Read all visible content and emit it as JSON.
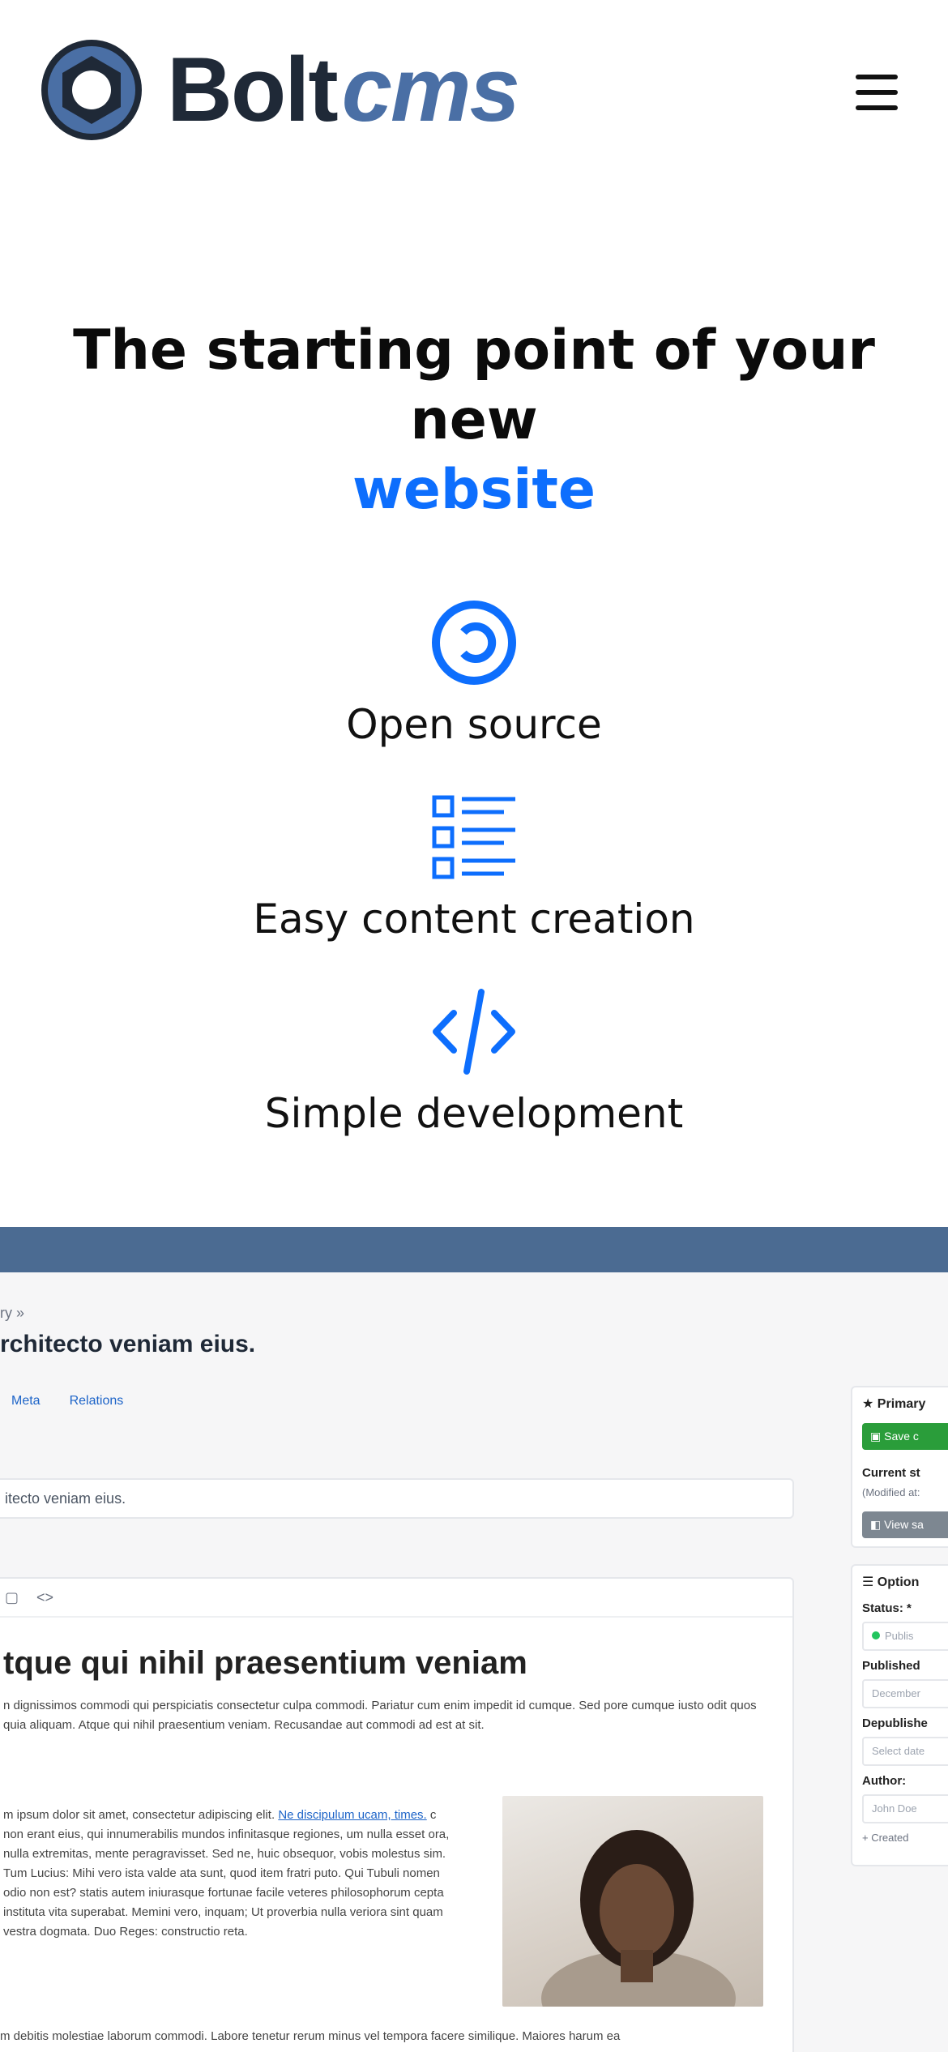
{
  "header": {
    "brand_bolt": "Bolt",
    "brand_cms": "cms",
    "menu_icon": "hamburger-menu-icon"
  },
  "hero": {
    "title_line1": "The starting point of your new",
    "title_accent": "website"
  },
  "features": [
    {
      "icon": "copyleft-icon",
      "label": "Open source"
    },
    {
      "icon": "checklist-icon",
      "label": "Easy content creation"
    },
    {
      "icon": "code-icon",
      "label": "Simple development"
    }
  ],
  "colors": {
    "accent": "#0d6efd",
    "logo_dark": "#1f2937",
    "logo_blue": "#4a6fa5",
    "preview_bar": "#4b6b92"
  },
  "preview": {
    "breadcrumb": "ry »",
    "title": "rchitecto veniam eius.",
    "tabs": [
      "Meta",
      "Relations"
    ],
    "title_field_value": "itecto veniam eius.",
    "editor_heading": "tque qui nihil praesentium veniam",
    "editor_para1": "n dignissimos commodi qui perspiciatis consectetur culpa commodi. Pariatur cum enim impedit id cumque. Sed pore cumque iusto odit quos quia aliquam. Atque qui nihil praesentium veniam. Recusandae aut commodi ad est at sit.",
    "editor_para2_start": "m ipsum dolor sit amet, consectetur adipiscing elit.",
    "editor_para2_link": "Ne discipulum ucam, times.",
    "editor_para2_rest": "c non erant eius, qui innumerabilis mundos infinitasque regiones, um nulla esset ora, nulla extremitas, mente peragravisset. Sed ne, huic obsequor, vobis molestus sim. Tum Lucius: Mihi vero ista valde ata sunt, quod item fratri puto. Qui Tubuli nomen odio non est? statis autem iniurasque fortunae facile veteres philosophorum cepta instituta vita superabat. Memini vero, inquam; Ut proverbia nulla veriora sint quam vestra dogmata. Duo Reges: constructio reta.",
    "editor_bottom": "m debitis molestiae laborum commodi. Labore tenetur rerum minus vel tempora facere similique. Maiores harum ea",
    "sidebar": {
      "primary_heading": "Primary",
      "save_button": "Save c",
      "current_status_label": "Current st",
      "modified_at": "(Modified at:",
      "view_button": "View sa",
      "options_heading": "Option",
      "status_label": "Status: *",
      "status_value": "Publis",
      "published_label": "Published",
      "published_value": "December",
      "depublish_label": "Depublishe",
      "depublish_placeholder": "Select date",
      "author_label": "Author:",
      "author_value": "John Doe",
      "created_label": "+ Created"
    }
  }
}
